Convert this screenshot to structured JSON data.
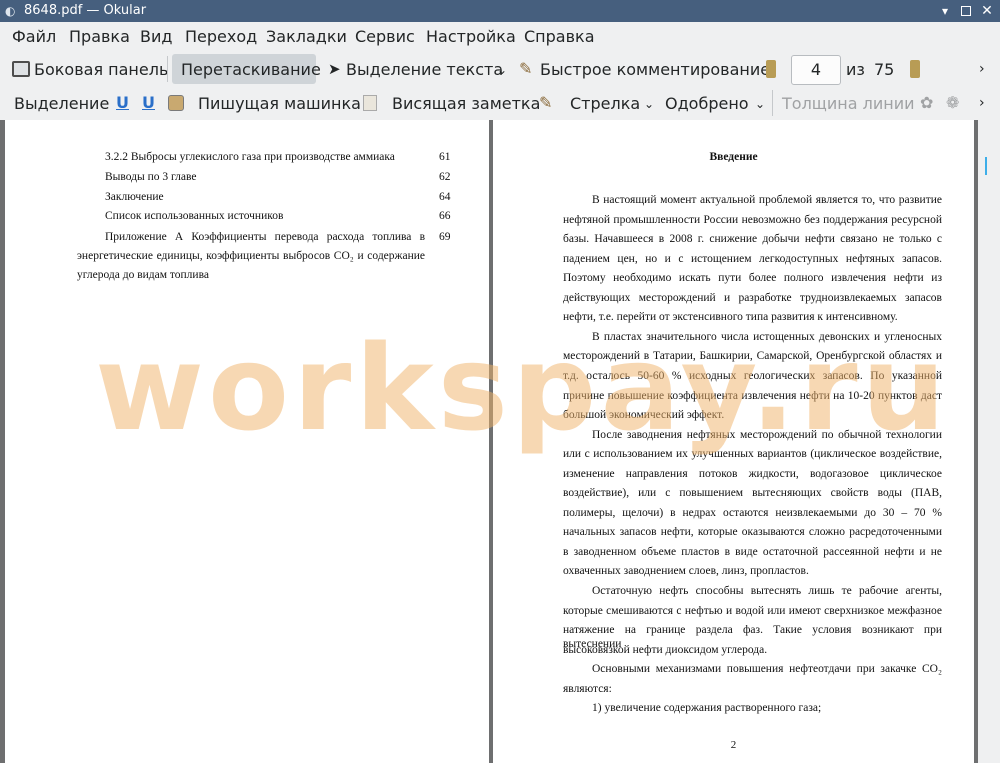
{
  "window": {
    "title": "8648.pdf  — Okular"
  },
  "menubar": {
    "items": [
      "Файл",
      "Правка",
      "Вид",
      "Переход",
      "Закладки",
      "Сервис",
      "Настройка",
      "Справка"
    ]
  },
  "toolbar1": {
    "sidebar_label": "Боковая панель",
    "drag_label": "Перетаскивание",
    "text_select_label": "Выделение текста",
    "quick_comment_label": "Быстрое комментирование",
    "page_value": "4",
    "page_of_label": "из",
    "page_total": "75"
  },
  "toolbar2": {
    "selection_label": "Выделение",
    "typewriter_label": "Пишущая машинка",
    "sticky_note_label": "Висящая заметка",
    "arrow_label": "Стрелка",
    "approved_label": "Одобрено",
    "line_width_label": "Толщина линии"
  },
  "watermark": "workspay.ru",
  "page_left": {
    "toc": [
      {
        "text": "3.2.2 Выбросы углекислого газа при производстве аммиака",
        "page": "61"
      },
      {
        "text": "Выводы по 3 главе",
        "page": "62"
      },
      {
        "text": "Заключение",
        "page": "64"
      },
      {
        "text": "Список использованных источников",
        "page": "66"
      },
      {
        "text": "Приложение А Коэффициенты перевода расхода топлива в",
        "page": "69"
      }
    ],
    "toc_cont_1": "энергетические единицы, коэффициенты выбросов CO₂ и содержание",
    "toc_cont_2": "углерода до видам топлива"
  },
  "page_right": {
    "heading": "Введение",
    "lines": [
      "В настоящий момент актуальной проблемой является то, что развитие",
      "нефтяной промышленности России невозможно без поддержания ресурсной",
      "базы. Начавшееся в 2008 г. снижение добычи нефти связано не только с",
      "падением цен, но и с истощением легкодоступных нефтяных запасов.",
      "Поэтому необходимо искать пути более полного извлечения нефти из",
      "действующих месторождений и разработке трудноизвлекаемых запасов",
      "нефти, т.е. перейти от экстенсивного типа развития к интенсивному.",
      "В пластах значительного числа истощенных девонских и угленосных",
      "месторождений в Татарии, Башкирии, Самарской, Оренбургской областях и",
      "т.д. осталось 50-60 % исходных геологических запасов. По указанной",
      "причине повышение коэффициента извлечения нефти на 10-20 пунктов даст",
      "большой экономический эффект.",
      "После заводнения нефтяных месторождений по обычной технологии",
      "или с использованием их улучшенных вариантов (циклическое воздействие,",
      "изменение направления потоков жидкости, водогазовое циклическое",
      "воздействие), или с повышением вытесняющих свойств воды (ПАВ,",
      "полимеры, щелочи) в недрах остаются неизвлекаемыми до 30 – 70 %",
      "начальных запасов нефти, которые оказываются сложно расредоточенными",
      "в заводненном объеме пластов в виде остаточной рассеянной нефти и не",
      "охваченных заводнением слоев, линз, пропластов.",
      "Остаточную нефть способны вытеснять лишь те рабочие агенты,",
      "которые смешиваются с нефтью и водой или имеют сверхнизкое межфазное",
      "натяжение на границе раздела фаз. Такие условия возникают при вытеснении",
      "высоковязкой нефти диоксидом углерода.",
      "Основными механизмами повышения нефтеотдачи при закачке CO₂",
      "являются:",
      "1) увеличение содержания растворенного газа;"
    ],
    "page_number": "2"
  }
}
